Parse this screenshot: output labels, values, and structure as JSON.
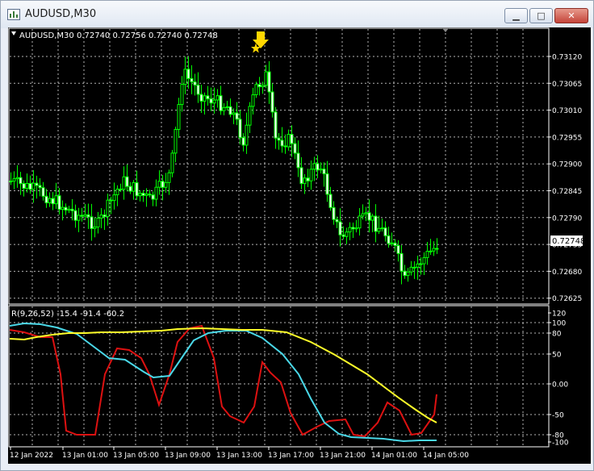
{
  "window": {
    "title": "AUDUSD,M30",
    "minimize_icon": "minimize-icon",
    "maximize_icon": "maximize-icon",
    "close_icon": "close-icon"
  },
  "chart": {
    "header": "AUDUSD,M30  0.72740 0.72756 0.72740 0.72748",
    "current_price": "0.72748",
    "price_axis": [
      "0.73120",
      "0.73065",
      "0.73010",
      "0.72955",
      "0.72900",
      "0.72845",
      "0.72790",
      "0.72735",
      "0.72680",
      "0.72625"
    ],
    "time_axis": [
      "12 Jan 2022",
      "13 Jan 01:00",
      "13 Jan 05:00",
      "13 Jan 09:00",
      "13 Jan 13:00",
      "13 Jan 17:00",
      "13 Jan 21:00",
      "14 Jan 01:00",
      "14 Jan 05:00"
    ],
    "colors": {
      "background": "#000000",
      "grid": "#ffffff",
      "bull": "#000000",
      "bear": "#ffffff",
      "wick": "#00ff00",
      "signal": "#ffd700"
    }
  },
  "indicator": {
    "header": "R(9,26,52) -15.4 -91.4 -60.2",
    "axis": [
      "120",
      "100",
      "80",
      "50",
      "0.00",
      "-50",
      "-80",
      "-100"
    ],
    "colors": {
      "fast": "#dd1111",
      "mid": "#4ad8e8",
      "slow": "#ffff2a"
    }
  },
  "chart_data": {
    "type": "line",
    "title": "R(9,26,52)",
    "series": [
      {
        "name": "9",
        "color": "#dd1111",
        "values": []
      },
      {
        "name": "26",
        "color": "#4ad8e8",
        "values": []
      },
      {
        "name": "52",
        "color": "#ffff2a",
        "values": []
      }
    ],
    "ylim": [
      -100,
      120
    ],
    "candles": {
      "pair": "AUDUSD",
      "timeframe": "M30",
      "last": {
        "open": 0.7274,
        "high": 0.72756,
        "low": 0.7274,
        "close": 0.72748
      }
    }
  }
}
